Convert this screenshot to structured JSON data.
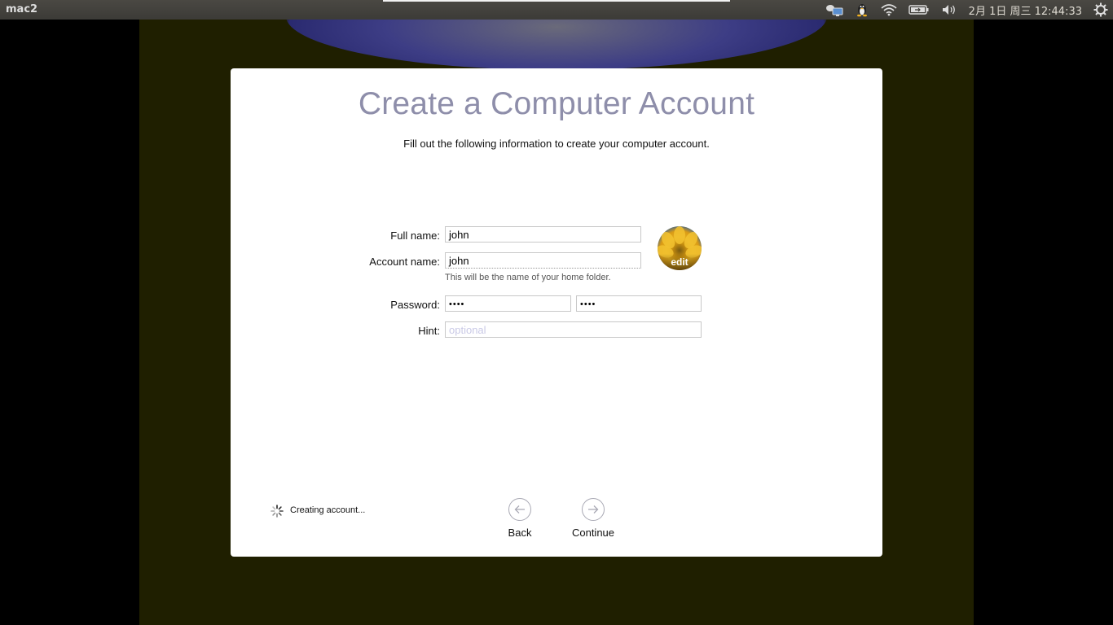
{
  "topbar": {
    "window_title": "mac2",
    "clock": "2月 1日 周三 12:44:33",
    "icons": [
      "network-display-icon",
      "linux-tux-icon",
      "wifi-icon",
      "battery-icon",
      "volume-icon",
      "settings-gear-icon"
    ]
  },
  "dialog": {
    "title": "Create a Computer Account",
    "subtitle": "Fill out the following information to create your computer account.",
    "full_name": {
      "label": "Full name:",
      "value": "john"
    },
    "account_name": {
      "label": "Account name:",
      "value": "john",
      "helper": "This will be the name of your home folder."
    },
    "password": {
      "label": "Password:",
      "value": "••••",
      "verify_value": "••••"
    },
    "hint": {
      "label": "Hint:",
      "placeholder": "optional"
    },
    "avatar": {
      "edit_label": "edit"
    },
    "status_text": "Creating account...",
    "back_label": "Back",
    "continue_label": "Continue"
  },
  "colors": {
    "title": "#8e8eaa",
    "vm_background": "#1f1f00",
    "panel": "#3c3b37"
  }
}
